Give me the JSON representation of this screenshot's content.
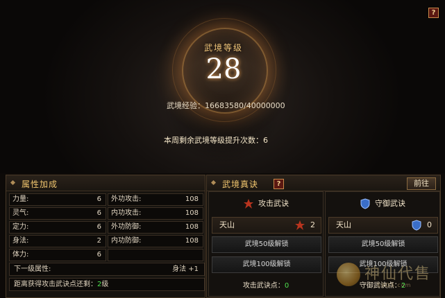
{
  "banner": {
    "level_title": "武境等级",
    "level_value": "28",
    "exp_label": "武境经验：",
    "exp_value": "16683580/40000000",
    "weekly_label": "本周剩余武境等级提升次数：",
    "weekly_value": "6",
    "help": "?"
  },
  "attributes": {
    "title": "属性加成",
    "left": [
      {
        "label": "力量:",
        "value": "6"
      },
      {
        "label": "灵气:",
        "value": "6"
      },
      {
        "label": "定力:",
        "value": "6"
      },
      {
        "label": "身法:",
        "value": "2"
      },
      {
        "label": "体力:",
        "value": "6"
      }
    ],
    "right": [
      {
        "label": "外功攻击:",
        "value": "108"
      },
      {
        "label": "内功攻击:",
        "value": "108"
      },
      {
        "label": "外功防御:",
        "value": "108"
      },
      {
        "label": "内功防御:",
        "value": "108"
      },
      {
        "label": "",
        "value": ""
      }
    ],
    "next_label": "下一级属性:",
    "next_value": "身法 +1",
    "distance_label": "距离获得攻击武诀点还剩：",
    "distance_value": "2",
    "distance_unit": "级"
  },
  "skills": {
    "title": "武境真诀",
    "help": "?",
    "goto_label": "前往",
    "attack": {
      "title": "攻击武诀",
      "name": "天山",
      "count": "2",
      "lock1": "武境50级解锁",
      "lock2": "武境100级解锁",
      "points_label": "攻击武诀点：",
      "points_value": "0"
    },
    "defense": {
      "title": "守御武诀",
      "name": "天山",
      "count": "0",
      "lock1": "武境50级解锁",
      "lock2": "武境100级解锁",
      "points_label": "守御武诀点：",
      "points_value": "2"
    }
  },
  "colors": {
    "gold_title": "#f0c56e",
    "green_value": "#4ee04e",
    "attack_icon": "#b8341e",
    "defense_icon": "#3a6ec8"
  },
  "watermark": {
    "text": "神仙代售",
    "sub": "SXDS.com"
  }
}
